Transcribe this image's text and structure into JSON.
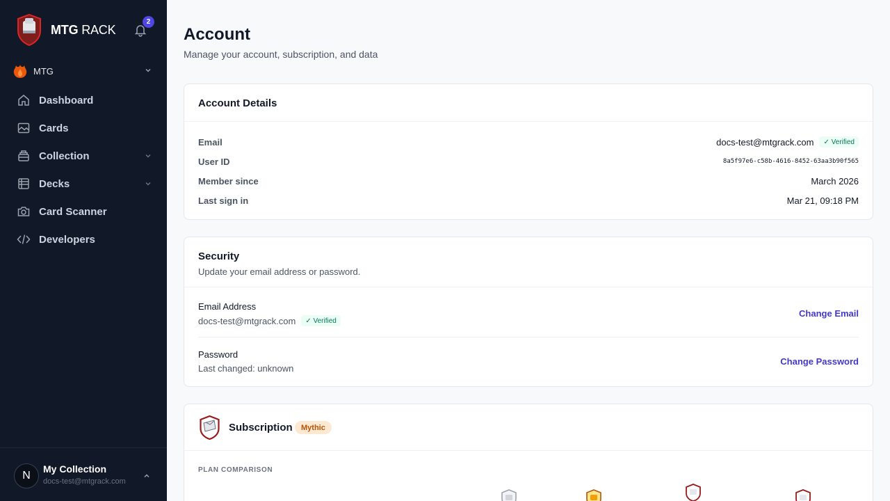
{
  "brand": {
    "name_bold": "MTG",
    "name_light": "RACK",
    "notifications": "2"
  },
  "game": {
    "label": "MTG"
  },
  "nav": [
    {
      "label": "Dashboard",
      "icon": "home-icon",
      "has_chevron": false
    },
    {
      "label": "Cards",
      "icon": "image-icon",
      "has_chevron": false
    },
    {
      "label": "Collection",
      "icon": "collection-icon",
      "has_chevron": true
    },
    {
      "label": "Decks",
      "icon": "deck-icon",
      "has_chevron": true
    },
    {
      "label": "Card Scanner",
      "icon": "camera-icon",
      "has_chevron": false
    },
    {
      "label": "Developers",
      "icon": "code-icon",
      "has_chevron": false
    }
  ],
  "user": {
    "initial": "N",
    "name": "My Collection",
    "email": "docs-test@mtgrack.com"
  },
  "page": {
    "title": "Account",
    "subtitle": "Manage your account, subscription, and data"
  },
  "account": {
    "title": "Account Details",
    "rows": [
      {
        "label": "Email",
        "value": "docs-test@mtgrack.com",
        "badge": "✓ Verified"
      },
      {
        "label": "User ID",
        "value": "8a5f97e6-c58b-4616-8452-63aa3b90f565"
      },
      {
        "label": "Member since",
        "value": "March 2026"
      },
      {
        "label": "Last sign in",
        "value": "Mar 21, 09:18 PM"
      }
    ]
  },
  "security": {
    "title": "Security",
    "description": "Update your email address or password.",
    "email": {
      "label": "Email Address",
      "value": "docs-test@mtgrack.com",
      "badge": "✓ Verified",
      "action": "Change Email"
    },
    "password": {
      "label": "Password",
      "value": "Last changed: unknown",
      "action": "Change Password"
    }
  },
  "subscription": {
    "title": "Subscription",
    "tier": "Mythic",
    "plan_label": "PLAN COMPARISON"
  },
  "colors": {
    "sidebar": "#111827",
    "accent": "#4338ca",
    "badge": "#4f46e5",
    "shield": "#b91c1c"
  }
}
